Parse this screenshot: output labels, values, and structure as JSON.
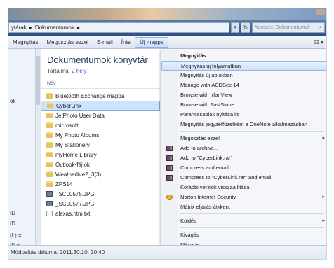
{
  "address": {
    "crumb_prefix": "ytárak",
    "crumb_current": "Dokumentumok",
    "search_placeholder": "Keresés: Dokumentumok"
  },
  "toolbar": {
    "items": [
      "Megnyitás",
      "Megosztás ezzel",
      "E-mail",
      "Írás",
      "Új mappa"
    ],
    "highlight_index": 0,
    "view_label": "☷ ▾"
  },
  "nav": {
    "fragments": [
      "ok",
      "ID",
      "ID",
      "(I:) =",
      "(l) ="
    ]
  },
  "library": {
    "title": "Dokumentumok könyvtár",
    "includes_label": "Tartalma:",
    "includes_link": "2 hely",
    "column_header": "Név"
  },
  "files": [
    {
      "name": "Bluetooth Exchange mappa",
      "type": "folder",
      "selected": false
    },
    {
      "name": "CyberLink",
      "type": "folder",
      "selected": true
    },
    {
      "name": "JetPhoto User Data",
      "type": "folder",
      "selected": false
    },
    {
      "name": "microsoft",
      "type": "folder",
      "selected": false
    },
    {
      "name": "My Photo Albums",
      "type": "folder",
      "selected": false
    },
    {
      "name": "My Stationery",
      "type": "folder",
      "selected": false
    },
    {
      "name": "myHome Library",
      "type": "folder",
      "selected": false
    },
    {
      "name": "Outlook-fájlok",
      "type": "folder",
      "selected": false
    },
    {
      "name": "Weatherlive2_3(3)",
      "type": "folder",
      "selected": false
    },
    {
      "name": "ZPS14",
      "type": "folder",
      "selected": false
    },
    {
      "name": "_SC00575.JPG",
      "type": "image",
      "selected": false
    },
    {
      "name": "_SC00577.JPG",
      "type": "image",
      "selected": false
    },
    {
      "name": "alexas.htm.txt",
      "type": "text",
      "selected": false
    }
  ],
  "status": {
    "text": "Módosítás dátuma: 2011.30.10. 20:40"
  },
  "context_menu": {
    "items": [
      {
        "label": "Megnyitás",
        "bold": true,
        "highlight": false,
        "arrow": false,
        "icon": ""
      },
      {
        "label": "Megnyitás új folyamatban",
        "bold": false,
        "highlight": true,
        "arrow": false,
        "icon": ""
      },
      {
        "label": "Megnyitás új ablakban",
        "bold": false,
        "highlight": false,
        "arrow": false,
        "icon": ""
      },
      {
        "label": "Manage with ACDSee 14",
        "bold": false,
        "highlight": false,
        "arrow": false,
        "icon": ""
      },
      {
        "label": "Browse with IrfanView",
        "bold": false,
        "highlight": false,
        "arrow": false,
        "icon": ""
      },
      {
        "label": "Browse with FastStone",
        "bold": false,
        "highlight": false,
        "arrow": false,
        "icon": ""
      },
      {
        "label": "Parancssablak nyitása itt",
        "bold": false,
        "highlight": false,
        "arrow": false,
        "icon": ""
      },
      {
        "label": "Megnyitás jegyzetfüzetként a OneNote alkalmazásban",
        "bold": false,
        "highlight": false,
        "arrow": false,
        "icon": ""
      },
      {
        "separator": true
      },
      {
        "label": "Megosztás ezzel",
        "bold": false,
        "highlight": false,
        "arrow": true,
        "icon": ""
      },
      {
        "label": "Add to archive...",
        "bold": false,
        "highlight": false,
        "arrow": false,
        "icon": "rar"
      },
      {
        "label": "Add to \"CyberLink.rar\"",
        "bold": false,
        "highlight": false,
        "arrow": false,
        "icon": "rar"
      },
      {
        "label": "Compress and email...",
        "bold": false,
        "highlight": false,
        "arrow": false,
        "icon": "rar"
      },
      {
        "label": "Compress to \"CyberLink.rar\" and email",
        "bold": false,
        "highlight": false,
        "arrow": false,
        "icon": "rar"
      },
      {
        "label": "Korábbi verziók visszaállítása",
        "bold": false,
        "highlight": false,
        "arrow": false,
        "icon": ""
      },
      {
        "label": "Norton Internet Security",
        "bold": false,
        "highlight": false,
        "arrow": true,
        "icon": "norton"
      },
      {
        "label": "Mátrix eljárás átkkent",
        "bold": false,
        "highlight": false,
        "arrow": false,
        "icon": ""
      },
      {
        "separator": true
      },
      {
        "label": "Küldés",
        "bold": false,
        "highlight": false,
        "arrow": true,
        "icon": ""
      },
      {
        "separator": true
      },
      {
        "label": "Kivágás",
        "bold": false,
        "highlight": false,
        "arrow": false,
        "icon": ""
      },
      {
        "label": "Másolás",
        "bold": false,
        "highlight": false,
        "arrow": false,
        "icon": ""
      }
    ]
  }
}
